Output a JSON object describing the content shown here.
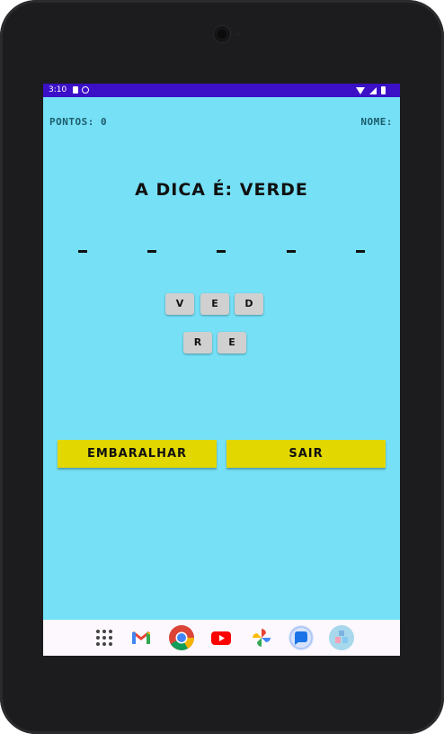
{
  "status_bar": {
    "time": "3:10"
  },
  "game": {
    "score_label": "PONTOS: 0",
    "name_label": "NOME:",
    "hint": "A DICA É: VERDE",
    "slots": [
      "_",
      "_",
      "_",
      "_",
      "_"
    ],
    "tiles_row1": [
      "V",
      "E",
      "D"
    ],
    "tiles_row2": [
      "R",
      "E"
    ],
    "shuffle_button": "EMBARALHAR",
    "exit_button": "SAIR"
  },
  "dock": {
    "apps": [
      "apps-icon",
      "gmail-icon",
      "chrome-icon",
      "youtube-icon",
      "photos-icon",
      "messages-icon",
      "kids-space-icon"
    ]
  },
  "colors": {
    "screen_bg": "#75e0f6",
    "status_bar": "#3b10c7",
    "button": "#e2d800",
    "tile": "#d0d0d0"
  }
}
